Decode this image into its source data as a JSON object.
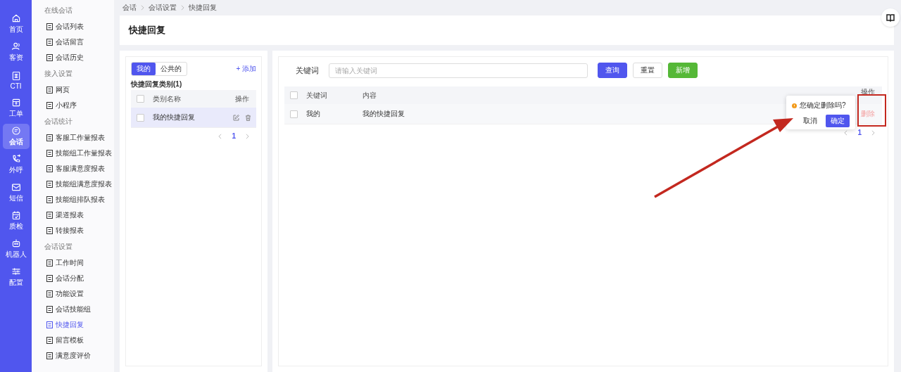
{
  "rail": [
    {
      "label": "首页",
      "selected": false
    },
    {
      "label": "客资",
      "selected": false
    },
    {
      "label": "CTI",
      "selected": false
    },
    {
      "label": "工单",
      "selected": false
    },
    {
      "label": "会话",
      "selected": true
    },
    {
      "label": "外呼",
      "selected": false
    },
    {
      "label": "短信",
      "selected": false
    },
    {
      "label": "质检",
      "selected": false
    },
    {
      "label": "机器人",
      "selected": false
    },
    {
      "label": "配置",
      "selected": false
    }
  ],
  "sidebar": [
    {
      "title": "在线会话",
      "items": [
        {
          "label": "会话列表",
          "selected": false
        },
        {
          "label": "会话留言",
          "selected": false
        },
        {
          "label": "会话历史",
          "selected": false
        }
      ]
    },
    {
      "title": "接入设置",
      "items": [
        {
          "label": "网页",
          "selected": false
        },
        {
          "label": "小程序",
          "selected": false
        }
      ]
    },
    {
      "title": "会话统计",
      "items": [
        {
          "label": "客服工作量报表",
          "selected": false
        },
        {
          "label": "技能组工作量报表",
          "selected": false
        },
        {
          "label": "客服满意度报表",
          "selected": false
        },
        {
          "label": "技能组满意度报表",
          "selected": false
        },
        {
          "label": "技能组排队报表",
          "selected": false
        },
        {
          "label": "渠道报表",
          "selected": false
        },
        {
          "label": "转接报表",
          "selected": false
        }
      ]
    },
    {
      "title": "会话设置",
      "items": [
        {
          "label": "工作时间",
          "selected": false
        },
        {
          "label": "会话分配",
          "selected": false
        },
        {
          "label": "功能设置",
          "selected": false
        },
        {
          "label": "会话技能组",
          "selected": false
        },
        {
          "label": "快捷回复",
          "selected": true
        },
        {
          "label": "留言模板",
          "selected": false
        },
        {
          "label": "满意度评价",
          "selected": false
        }
      ]
    }
  ],
  "breadcrumb": [
    "会话",
    "会话设置",
    "快捷回复"
  ],
  "page_title": "快捷回复",
  "categories": {
    "tabs": [
      {
        "label": "我的",
        "selected": true
      },
      {
        "label": "公共的",
        "selected": false
      }
    ],
    "add_link": "+ 添加",
    "heading": "快捷回复类别(1)",
    "all_checked": false,
    "columns": [
      "类别名称",
      "操作"
    ],
    "rows": [
      {
        "name": "我的快捷回复",
        "checked": false,
        "selected": true
      }
    ],
    "pages": [
      {
        "label": "1",
        "selected": true
      }
    ]
  },
  "replies": {
    "search": {
      "label": "关键词",
      "placeholder": "请输入关键词"
    },
    "buttons": [
      {
        "label": "查询",
        "kind": "primary"
      },
      {
        "label": "重置",
        "kind": "default"
      },
      {
        "label": "新增",
        "kind": "success"
      }
    ],
    "all_checked": false,
    "columns": [
      "关键词",
      "内容",
      "操作"
    ],
    "rows": [
      {
        "keyword": "我的",
        "content": "我的快捷回复",
        "action": "删除",
        "checked": false
      }
    ],
    "pages": [
      {
        "label": "1",
        "selected": true
      }
    ]
  },
  "popconfirm": {
    "message": "您确定删除吗?",
    "cancel": "取消",
    "confirm": "确定"
  }
}
